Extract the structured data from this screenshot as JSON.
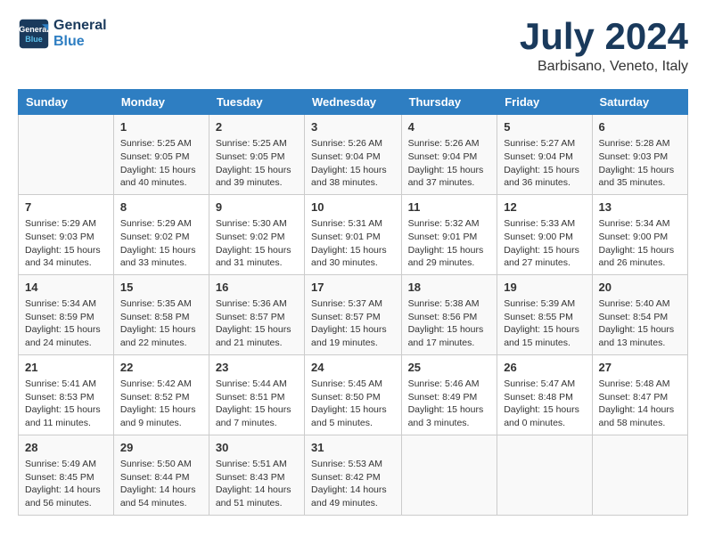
{
  "logo": {
    "line1": "General",
    "line2": "Blue"
  },
  "title": "July 2024",
  "subtitle": "Barbisano, Veneto, Italy",
  "headers": [
    "Sunday",
    "Monday",
    "Tuesday",
    "Wednesday",
    "Thursday",
    "Friday",
    "Saturday"
  ],
  "weeks": [
    [
      {
        "day": "",
        "info": ""
      },
      {
        "day": "1",
        "info": "Sunrise: 5:25 AM\nSunset: 9:05 PM\nDaylight: 15 hours\nand 40 minutes."
      },
      {
        "day": "2",
        "info": "Sunrise: 5:25 AM\nSunset: 9:05 PM\nDaylight: 15 hours\nand 39 minutes."
      },
      {
        "day": "3",
        "info": "Sunrise: 5:26 AM\nSunset: 9:04 PM\nDaylight: 15 hours\nand 38 minutes."
      },
      {
        "day": "4",
        "info": "Sunrise: 5:26 AM\nSunset: 9:04 PM\nDaylight: 15 hours\nand 37 minutes."
      },
      {
        "day": "5",
        "info": "Sunrise: 5:27 AM\nSunset: 9:04 PM\nDaylight: 15 hours\nand 36 minutes."
      },
      {
        "day": "6",
        "info": "Sunrise: 5:28 AM\nSunset: 9:03 PM\nDaylight: 15 hours\nand 35 minutes."
      }
    ],
    [
      {
        "day": "7",
        "info": "Sunrise: 5:29 AM\nSunset: 9:03 PM\nDaylight: 15 hours\nand 34 minutes."
      },
      {
        "day": "8",
        "info": "Sunrise: 5:29 AM\nSunset: 9:02 PM\nDaylight: 15 hours\nand 33 minutes."
      },
      {
        "day": "9",
        "info": "Sunrise: 5:30 AM\nSunset: 9:02 PM\nDaylight: 15 hours\nand 31 minutes."
      },
      {
        "day": "10",
        "info": "Sunrise: 5:31 AM\nSunset: 9:01 PM\nDaylight: 15 hours\nand 30 minutes."
      },
      {
        "day": "11",
        "info": "Sunrise: 5:32 AM\nSunset: 9:01 PM\nDaylight: 15 hours\nand 29 minutes."
      },
      {
        "day": "12",
        "info": "Sunrise: 5:33 AM\nSunset: 9:00 PM\nDaylight: 15 hours\nand 27 minutes."
      },
      {
        "day": "13",
        "info": "Sunrise: 5:34 AM\nSunset: 9:00 PM\nDaylight: 15 hours\nand 26 minutes."
      }
    ],
    [
      {
        "day": "14",
        "info": "Sunrise: 5:34 AM\nSunset: 8:59 PM\nDaylight: 15 hours\nand 24 minutes."
      },
      {
        "day": "15",
        "info": "Sunrise: 5:35 AM\nSunset: 8:58 PM\nDaylight: 15 hours\nand 22 minutes."
      },
      {
        "day": "16",
        "info": "Sunrise: 5:36 AM\nSunset: 8:57 PM\nDaylight: 15 hours\nand 21 minutes."
      },
      {
        "day": "17",
        "info": "Sunrise: 5:37 AM\nSunset: 8:57 PM\nDaylight: 15 hours\nand 19 minutes."
      },
      {
        "day": "18",
        "info": "Sunrise: 5:38 AM\nSunset: 8:56 PM\nDaylight: 15 hours\nand 17 minutes."
      },
      {
        "day": "19",
        "info": "Sunrise: 5:39 AM\nSunset: 8:55 PM\nDaylight: 15 hours\nand 15 minutes."
      },
      {
        "day": "20",
        "info": "Sunrise: 5:40 AM\nSunset: 8:54 PM\nDaylight: 15 hours\nand 13 minutes."
      }
    ],
    [
      {
        "day": "21",
        "info": "Sunrise: 5:41 AM\nSunset: 8:53 PM\nDaylight: 15 hours\nand 11 minutes."
      },
      {
        "day": "22",
        "info": "Sunrise: 5:42 AM\nSunset: 8:52 PM\nDaylight: 15 hours\nand 9 minutes."
      },
      {
        "day": "23",
        "info": "Sunrise: 5:44 AM\nSunset: 8:51 PM\nDaylight: 15 hours\nand 7 minutes."
      },
      {
        "day": "24",
        "info": "Sunrise: 5:45 AM\nSunset: 8:50 PM\nDaylight: 15 hours\nand 5 minutes."
      },
      {
        "day": "25",
        "info": "Sunrise: 5:46 AM\nSunset: 8:49 PM\nDaylight: 15 hours\nand 3 minutes."
      },
      {
        "day": "26",
        "info": "Sunrise: 5:47 AM\nSunset: 8:48 PM\nDaylight: 15 hours\nand 0 minutes."
      },
      {
        "day": "27",
        "info": "Sunrise: 5:48 AM\nSunset: 8:47 PM\nDaylight: 14 hours\nand 58 minutes."
      }
    ],
    [
      {
        "day": "28",
        "info": "Sunrise: 5:49 AM\nSunset: 8:45 PM\nDaylight: 14 hours\nand 56 minutes."
      },
      {
        "day": "29",
        "info": "Sunrise: 5:50 AM\nSunset: 8:44 PM\nDaylight: 14 hours\nand 54 minutes."
      },
      {
        "day": "30",
        "info": "Sunrise: 5:51 AM\nSunset: 8:43 PM\nDaylight: 14 hours\nand 51 minutes."
      },
      {
        "day": "31",
        "info": "Sunrise: 5:53 AM\nSunset: 8:42 PM\nDaylight: 14 hours\nand 49 minutes."
      },
      {
        "day": "",
        "info": ""
      },
      {
        "day": "",
        "info": ""
      },
      {
        "day": "",
        "info": ""
      }
    ]
  ]
}
